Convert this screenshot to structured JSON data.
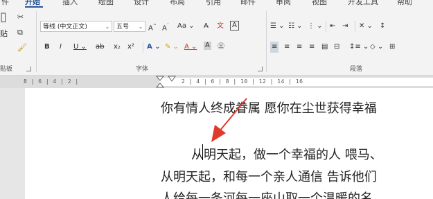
{
  "tabs": [
    "件",
    "开始",
    "插入",
    "绘图",
    "设计",
    "布局",
    "引用",
    "邮件",
    "审阅",
    "视图",
    "开发工具",
    "帮助"
  ],
  "active_tab": "开始",
  "clipboard": {
    "paste_label": "贴",
    "group_label": "贴板"
  },
  "font": {
    "name": "等线 (中文正文)",
    "size": "五号",
    "grow": "A",
    "shrink": "A",
    "case": "Aa",
    "bold": "B",
    "italic": "I",
    "underline": "U",
    "strike": "ab",
    "subscript": "x₂",
    "superscript": "x²",
    "group_label": "字体"
  },
  "paragraph": {
    "group_label": "段落"
  },
  "ruler": {
    "left_marks": "8 | 6 | 4 | 2 |",
    "right_marks": "2 | 4 | 6 | 8 | 10 | 12 | 14 | 16"
  },
  "document": {
    "line1": "你有情人终成眷属 愿你在尘世获得幸福",
    "line2": "从明天起，做一个幸福的人 喂马、",
    "line3": "从明天起，和每一个亲人通信 告诉他们",
    "line4": "人给每一条河每一座山取一个温暖的名"
  },
  "colors": {
    "accent": "#2b579a",
    "arrow": "#e03a2f"
  }
}
